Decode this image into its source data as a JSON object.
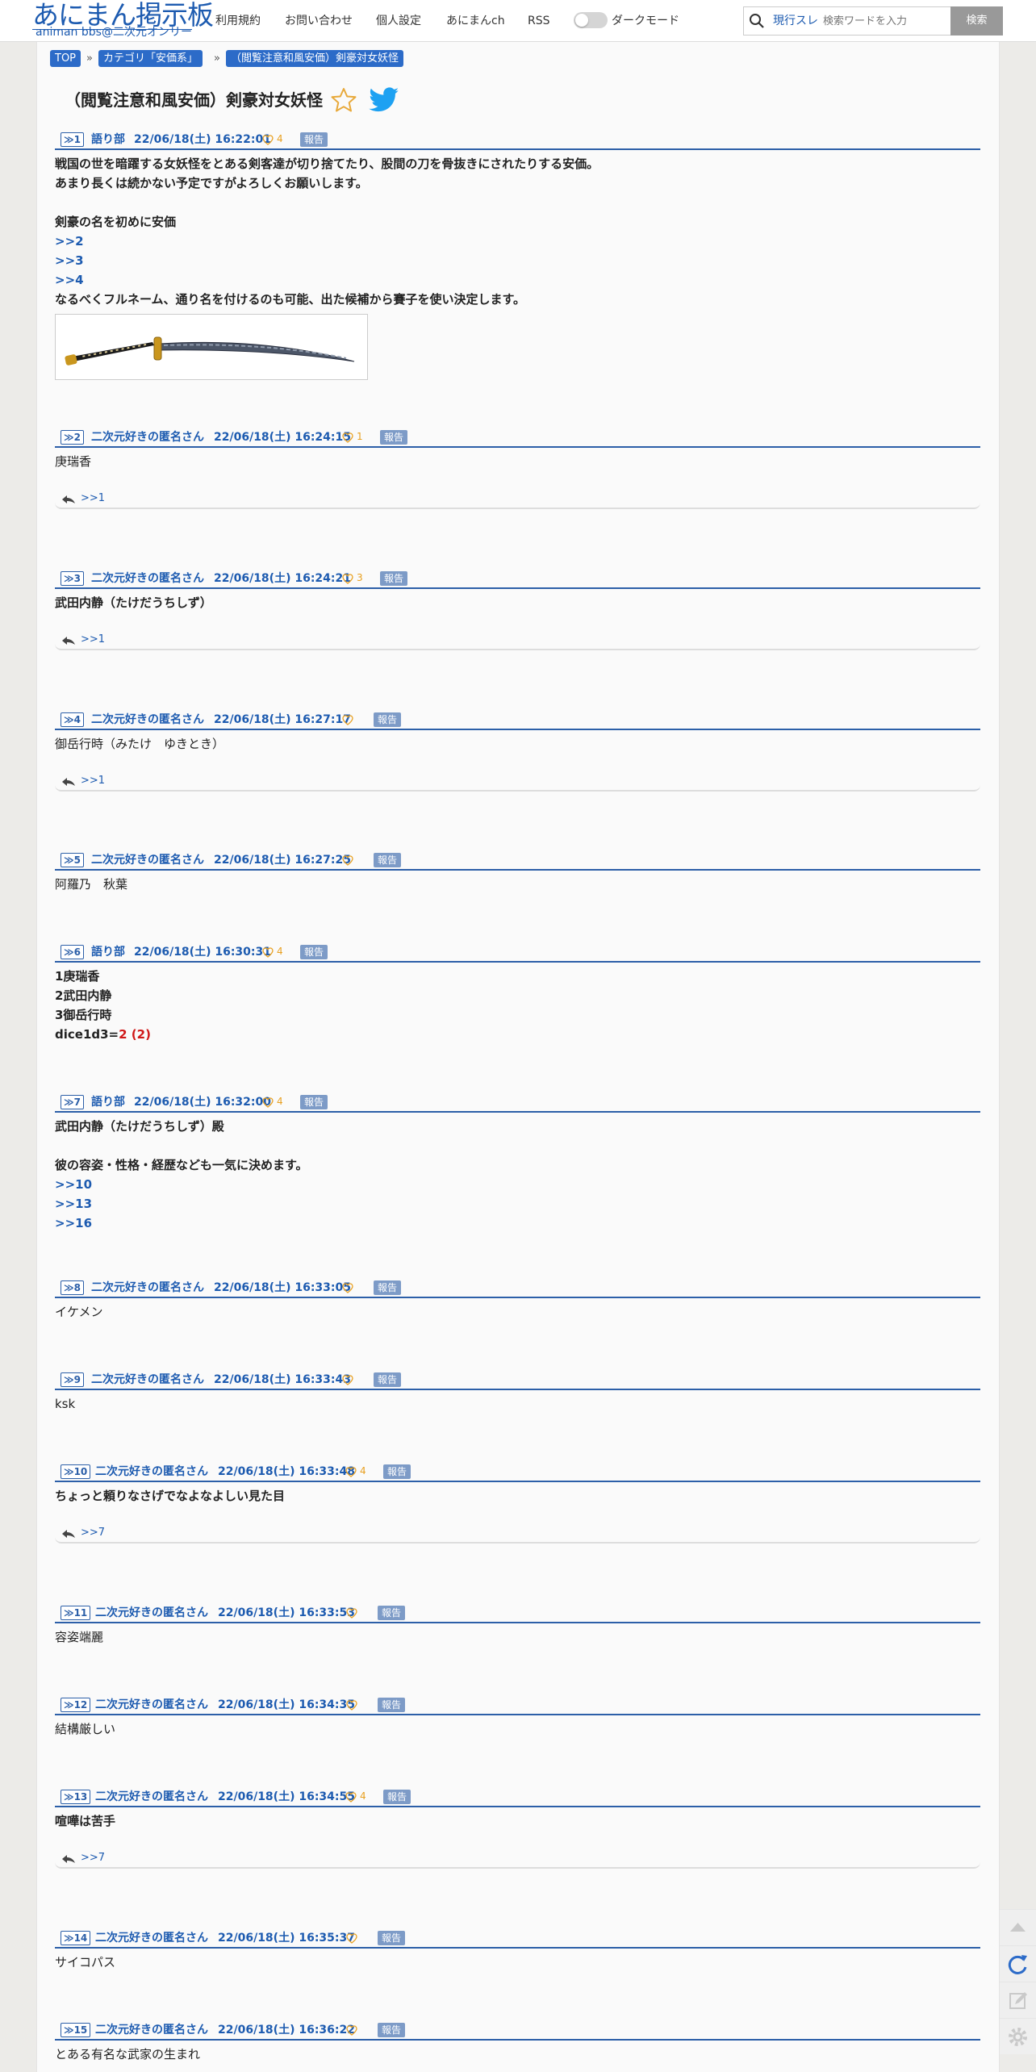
{
  "header": {
    "logo_main": "あにまん掲示板",
    "logo_sub": "animan bbs@二次元オンリー",
    "nav": [
      "利用規約",
      "お問い合わせ",
      "個人設定",
      "あにまんch",
      "RSS"
    ],
    "dark_mode": "ダークモード",
    "search_scope": "現行スレ",
    "search_placeholder": "検索ワードを入力",
    "search_button": "検索"
  },
  "breadcrumb": {
    "top": "TOP",
    "sep": "»",
    "category": "カテゴリ「安価系」",
    "current": "（閲覧注意和風安価）剣豪対女妖怪"
  },
  "thread_title": "（閲覧注意和風安価）剣豪対女妖怪",
  "report_label": "報告",
  "posts": [
    {
      "num": "≫1",
      "author": "語り部",
      "date": "22/06/18(土) 16:22:01",
      "likes": "4",
      "lines": [
        "戦国の世を暗躍する女妖怪をとある剣客達が切り捨てたり、股間の刀を骨抜きにされたりする安価。",
        "あまり長くは続かない予定ですがよろしくお願いします。",
        "",
        "剣豪の名を初めに安価",
        ">>2",
        ">>3",
        ">>4",
        "なるべくフルネーム、通り名を付けるのも可能、出た候補から賽子を使い決定します。"
      ],
      "image": "katana"
    },
    {
      "num": "≫2",
      "author": "二次元好きの匿名さん",
      "date": "22/06/18(土) 16:24:15",
      "likes": "1",
      "lines": [
        "庚瑞香"
      ],
      "reply": ">>1"
    },
    {
      "num": "≫3",
      "author": "二次元好きの匿名さん",
      "date": "22/06/18(土) 16:24:21",
      "likes": "3",
      "lines": [
        "武田内静（たけだうちしず）"
      ],
      "reply": ">>1"
    },
    {
      "num": "≫4",
      "author": "二次元好きの匿名さん",
      "date": "22/06/18(土) 16:27:17",
      "likes": "",
      "lines": [
        "御岳行時（みたけ　ゆきとき）"
      ],
      "reply": ">>1"
    },
    {
      "num": "≫5",
      "author": "二次元好きの匿名さん",
      "date": "22/06/18(土) 16:27:25",
      "likes": "",
      "lines": [
        "阿羅乃　秋葉"
      ]
    },
    {
      "num": "≫6",
      "author": "語り部",
      "date": "22/06/18(土) 16:30:31",
      "likes": "4",
      "lines": [
        "1庚瑞香",
        "2武田内静",
        "3御岳行時"
      ],
      "dice": {
        "label": "dice1d3=",
        "result": "2 (2)"
      }
    },
    {
      "num": "≫7",
      "author": "語り部",
      "date": "22/06/18(土) 16:32:00",
      "likes": "4",
      "lines": [
        "武田内静（たけだうちしず）殿",
        "",
        "彼の容姿・性格・経歴なども一気に決めます。",
        ">>10",
        ">>13",
        ">>16"
      ]
    },
    {
      "num": "≫8",
      "author": "二次元好きの匿名さん",
      "date": "22/06/18(土) 16:33:05",
      "likes": "",
      "lines": [
        "イケメン"
      ]
    },
    {
      "num": "≫9",
      "author": "二次元好きの匿名さん",
      "date": "22/06/18(土) 16:33:43",
      "likes": "",
      "lines": [
        "ksk"
      ]
    },
    {
      "num": "≫10",
      "author": "二次元好きの匿名さん",
      "date": "22/06/18(土) 16:33:48",
      "likes": "4",
      "lines": [
        "ちょっと頼りなさげでなよなよしい見た目"
      ],
      "reply": ">>7"
    },
    {
      "num": "≫11",
      "author": "二次元好きの匿名さん",
      "date": "22/06/18(土) 16:33:53",
      "likes": "",
      "lines": [
        "容姿端麗"
      ]
    },
    {
      "num": "≫12",
      "author": "二次元好きの匿名さん",
      "date": "22/06/18(土) 16:34:35",
      "likes": "",
      "lines": [
        "結構厳しい"
      ]
    },
    {
      "num": "≫13",
      "author": "二次元好きの匿名さん",
      "date": "22/06/18(土) 16:34:55",
      "likes": "4",
      "lines": [
        "喧嘩は苦手"
      ],
      "reply": ">>7"
    },
    {
      "num": "≫14",
      "author": "二次元好きの匿名さん",
      "date": "22/06/18(土) 16:35:37",
      "likes": "",
      "lines": [
        "サイコパス"
      ]
    },
    {
      "num": "≫15",
      "author": "二次元好きの匿名さん",
      "date": "22/06/18(土) 16:36:22",
      "likes": "",
      "lines": [
        "とある有名な武家の生まれ"
      ]
    }
  ]
}
